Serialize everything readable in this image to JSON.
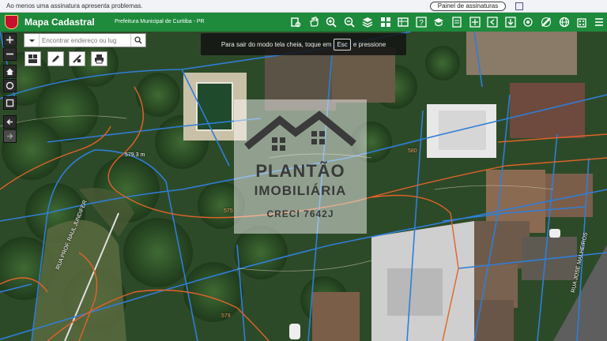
{
  "notice": {
    "text": "Ao menos uma assinatura apresenta problemas.",
    "button_label": "Painel de assinaturas"
  },
  "header": {
    "title": "Mapa Cadastral",
    "subtitle": "Prefeitura Municipal de Curitiba - PR",
    "brand_color": "#1e8a3c",
    "toolbar_icons": [
      "identify-icon",
      "pan-hand-icon",
      "zoom-in-icon",
      "zoom-out-icon",
      "layers-icon",
      "grid-icon",
      "table-icon",
      "help-icon",
      "education-icon",
      "print-frame-icon",
      "export-icon",
      "import-icon",
      "download-icon",
      "target-icon",
      "ruler-icon",
      "globe-icon",
      "building-icon",
      "menu-icon"
    ]
  },
  "search": {
    "placeholder": "Encontrar endereço ou lug",
    "value": ""
  },
  "fullscreen_toast": {
    "before": "Para sair do modo tela cheia, toque em",
    "key": "Esc",
    "after": "e pressione"
  },
  "map": {
    "measure_label": "579,3 m",
    "contour_labels": [
      "575",
      "580",
      "579"
    ],
    "street_labels": [
      "RUA PROF. RAUL JUNDIFER",
      "RUA JOSÉ MALHEIROS"
    ]
  },
  "watermark": {
    "line1": "PLANTÃO",
    "line2": "IMOBILIÁRIA",
    "line3": "CRECI 7642J"
  }
}
